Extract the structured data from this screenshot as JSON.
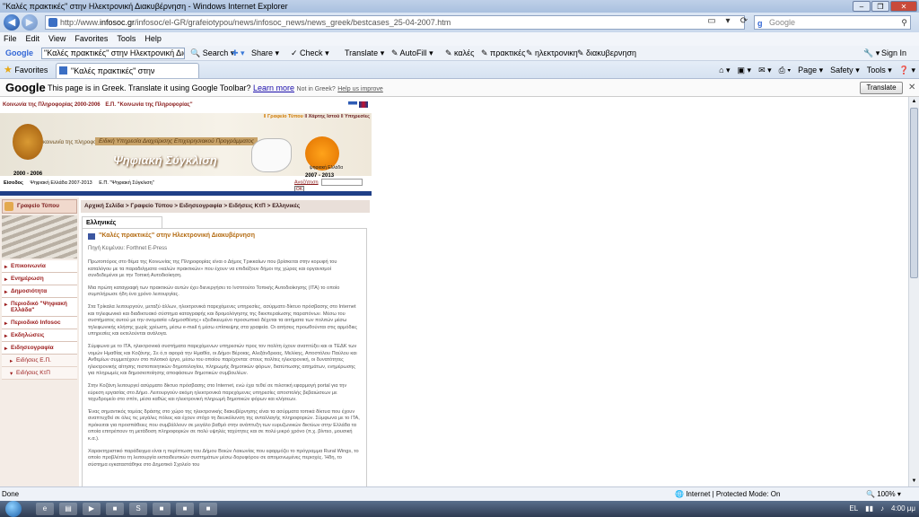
{
  "window": {
    "title": "\"Καλές πρακτικές\" στην Ηλεκτρονική Διακυβέρνηση - Windows Internet Explorer"
  },
  "address": {
    "prefix": "http://www.",
    "domain": "infosoc.gr",
    "path": "/infosoc/el-GR/grafeiotypou/news/infosoc_news/news_greek/bestcases_25-04-2007.htm"
  },
  "google_search": {
    "placeholder": "Google"
  },
  "menu": [
    "File",
    "Edit",
    "View",
    "Favorites",
    "Tools",
    "Help"
  ],
  "gtoolbar": {
    "logo": "Google",
    "query": "\"Καλές πρακτικές\" στην Ηλεκτρονική Διακυβέρνηση",
    "search": "Search",
    "share": "Share",
    "check": "Check",
    "translate": "Translate",
    "autofill": "AutoFill",
    "words": [
      "καλές",
      "πρακτικές",
      "ηλεκτρονικη",
      "διακυβερνηση"
    ],
    "signin": "Sign In"
  },
  "favorites": {
    "label": "Favorites"
  },
  "tab": {
    "title": "\"Καλές πρακτικές\" στην Ηλεκτρονική Διακ..."
  },
  "cmd": {
    "page": "Page",
    "safety": "Safety",
    "tools": "Tools"
  },
  "translatebar": {
    "logo": "Google",
    "msg": "This page is in Greek. Translate it using Google Toolbar?",
    "learn": "Learn more",
    "not_greek": "Not in Greek?",
    "help": "Help us improve",
    "button": "Translate"
  },
  "site": {
    "toplinks": [
      "Κοινωνία της Πληροφορίας 2000-2006",
      "Ε.Π. \"Κοινωνία της Πληροφορίας\""
    ],
    "rightlinks": {
      "press": "Γραφείο Τύπου",
      "map": "Χάρτης Ιστού",
      "services": "Υπηρεσίες"
    },
    "banner_sub": "Ειδική Υπηρεσία Διαχείρισης Επιχειρησιακού Προγράμματος",
    "banner_title": "Ψηφιακή Σύγκλιση",
    "left_logo_text": "κοινωνία της πληροφορίας",
    "year_left": "2000 - 2006",
    "year_right": "2007 - 2013",
    "right_logo_text": "ψηφιακή Ελλάδα",
    "subnav": [
      "Είσοδος",
      "Ψηφιακή Ελλάδα 2007-2013",
      "Ε.Π. \"Ψηφιακή Σύγκλιση\""
    ],
    "search_label": "Αναζήτηση",
    "search_ok": "OK",
    "sidebar_head": "Γραφείο Τύπου",
    "sidebar": {
      "items": [
        "Επικοινωνία",
        "Ενημέρωση",
        "Δημοσιότητα",
        "Περιοδικό \"Ψηφιακή Ελλάδα\"",
        "Περιοδικό Infosoc",
        "Εκδηλώσεις",
        "Ειδησεογραφία"
      ],
      "sub": [
        "Ειδήσεις Ε.Π.",
        "Ειδήσεις ΚτΠ"
      ]
    },
    "breadcrumb": "Αρχική Σελίδα > Γραφείο Τύπου > Ειδησεογραφία > Ειδήσεις ΚτΠ > Ελληνικές",
    "content_tab": "Ελληνικές",
    "article": {
      "title": "\"Καλές πρακτικές\" στην Ηλεκτρονική Διακυβέρνηση",
      "source": "Πηγή Κειμένου: Forthnet E-Press",
      "paragraphs": [
        "Πρωτοπόρος στο θέμα της Κοινωνίας της Πληροφορίας είναι ο Δήμος Τρικκαίων που βρίσκεται στην κορυφή του καταλόγου με τα παραδείγματα «καλών πρακτικών» που έχουν να επιδείξουν δήμοι της χώρας και οργανισμοί συνδεδεμένοι με την Τοπική Αυτοδιοίκηση.",
        "Μια πρώτη καταγραφή των πρακτικών αυτών έχει διενεργήσει το Ινστιτούτο Τοπικής Αυτοδιοίκησης (ΙΤΑ) το οποίο συμπλήρωσε ήδη ένα χρόνο λειτουργίας.",
        "Στα Τρίκαλα λειτουργούν, μεταξύ άλλων, ηλεκτρονικά παρεχόμενες υπηρεσίες, ασύρματο δίκτυο πρόσβασης στο Internet και τηλεφωνικό και διαδικτυακό σύστημα καταγραφής και δρομολόγησης της διεκπεραίωσης παραπόνων. Μέσω του συστήματος αυτού με την ονομασία «Δημοσθένης» εξειδικευμένο προσωπικό δέχεται τα αιτήματα των πολιτών μέσω τηλεφωνικής κλήσης χωρίς χρέωση, μέσω e-mail ή μέσω επίσκεψης στα γραφεία. Οι αιτήσεις προωθούνται στις αρμόδιες υπηρεσίες και εκτελούνται ανάλογα.",
        "Σύμφωνα με το ΙΤΑ, ηλεκτρονικά συστήματα παρεχόμενων υπηρεσιών προς τον πολίτη έχουν αναπτύξει και οι ΤΕΔΚ των νομών Ημαθίας και Κοζάνης. Σε ό,τι αφορά την Ημαθία, οι Δήμοι Βέροιας, Αλεξάνδρειας, Μελίκης, Αποστόλου Παύλου και Ανθεμίων συμμετέχουν στο πιλοτικό έργο, μέσω του οποίου παρέχονται: στους πολίτες ηλεκτρονική, οι δυνατότητες ηλεκτρονικής αίτησης πιστοποιητικών δημοτολογίου, πληρωμής δημοτικών φόρων, διατύπωσης αιτημάτων, ενημέρωσης για πληρωμές και δημοσιοποίησης αποφάσεων δημοτικών συμβουλίων.",
        "Στην Κοζάνη λειτουργεί ασύρματο δίκτυο πρόσβασης στο Internet, ενώ έχει τεθεί σε πιλοτική εφαρμογή portal για την εύρεση εργασίας στο Δήμο. Λειτουργούν ακόμη ηλεκτρονικά παρεχόμενες υπηρεσίες αποστολής βεβαιώσεων με ταχυδρομείο στο σπίτι, μέσα καθώς και ηλεκτρονική πληρωμή δημοτικών φόρων και κλήσεων.",
        "Ένας σημαντικός τομέας δράσης στο χώρο της ηλεκτρονικής διακυβέρνησης είναι τα ασύρματα τοπικά δίκτυα που έχουν αναπτυχθεί σε όλες τις μεγάλες πόλεις και έχουν στόχο τη διευκόλυνση της ανταλλαγής πληροφοριών. Σύμφωνα με το ΙΤΑ, πρόκειται για προσπάθειες που συμβάλλουν σε μεγάλο βαθμό στην ανάπτυξη των ευρυζωνικών δικτύων στην Ελλάδα τα οποία επιτρέπουν τη μετάδοση πληροφοριών σε πολύ υψηλές ταχύτητες και σε πολύ μικρό χρόνο (π.χ. βίντεο, μουσική κ.α.).",
        "Χαρακτηριστικό παράδειγμα είναι η περίπτωση του Δήμου Βοιών Λακωνίας που εφαρμόζει το πρόγραμμα Rural Wings, το οποίο προβλέπει τη λειτουργία εκπαιδευτικών συστημάτων μέσω δορυφόρου σε απομονωμένες περιοχές. Ήδη, το σύστημα εγκαταστάθηκε στο Δημοτικό Σχολείο του"
      ]
    }
  },
  "status": {
    "done": "Done",
    "zone": "Internet | Protected Mode: On",
    "zoom": "100%"
  },
  "taskbar": {
    "lang": "EL",
    "time": "4:00 μμ"
  }
}
